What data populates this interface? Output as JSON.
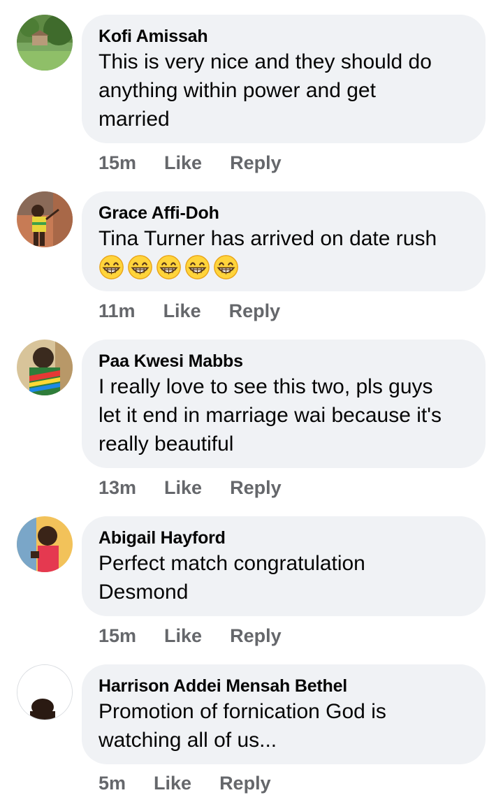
{
  "comments": [
    {
      "author": "Kofi Amissah",
      "text": "This is very nice and they should do\nanything within power and get\nmarried",
      "time": "15m",
      "like_label": "Like",
      "reply_label": "Reply",
      "avatar_icon": "profile-photo-outdoor-greenery"
    },
    {
      "author": "Grace Affi-Doh",
      "text": "Tina Turner has arrived on date rush",
      "emoji": [
        "😁",
        "😁",
        "😁",
        "😁",
        "😁"
      ],
      "emoji_name": "beaming-face-with-smiling-eyes",
      "time": "11m",
      "like_label": "Like",
      "reply_label": "Reply",
      "avatar_icon": "profile-photo-person-yellow-outfit"
    },
    {
      "author": "Paa Kwesi Mabbs",
      "text": "I really love to see this two,  pls guys\nlet it end in marriage wai because it's\nreally beautiful",
      "time": "13m",
      "like_label": "Like",
      "reply_label": "Reply",
      "avatar_icon": "profile-photo-person-colorful-shirt"
    },
    {
      "author": "Abigail Hayford",
      "text": "Perfect match congratulation\nDesmond",
      "time": "15m",
      "like_label": "Like",
      "reply_label": "Reply",
      "avatar_icon": "profile-photo-person-red-top"
    },
    {
      "author": "Harrison Addei Mensah Bethel",
      "text": "Promotion of fornication God is\nwatching all of us...",
      "time": "5m",
      "like_label": "Like",
      "reply_label": "Reply",
      "avatar_icon": "profile-photo-person-white-background"
    }
  ],
  "colors": {
    "bubble_bg": "#f0f2f5",
    "text": "#050505",
    "meta": "#65676b"
  }
}
